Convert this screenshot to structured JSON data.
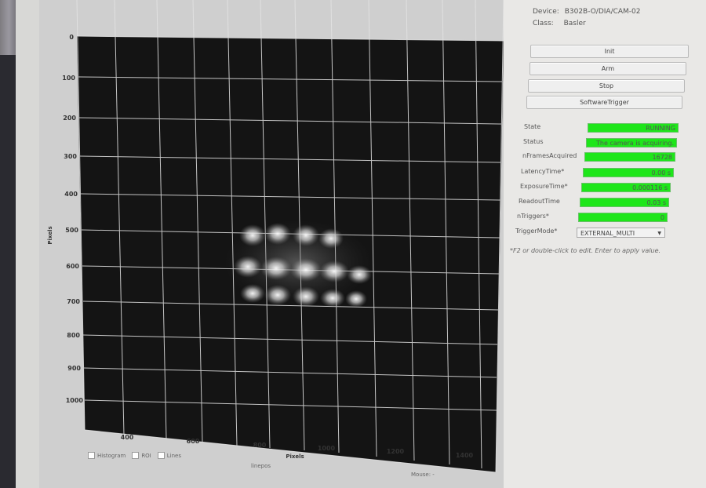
{
  "device": {
    "device_label": "Device:",
    "device_value": "B302B-O/DIA/CAM-02",
    "class_label": "Class:",
    "class_value": "Basler"
  },
  "buttons": {
    "init": "Init",
    "arm": "Arm",
    "stop": "Stop",
    "software_trigger": "SoftwareTrigger"
  },
  "attributes": [
    {
      "label": "State",
      "value": "RUNNING"
    },
    {
      "label": "Status",
      "value": "The camera is acquiring."
    },
    {
      "label": "nFramesAcquired",
      "value": "16728"
    },
    {
      "label": "LatencyTime*",
      "value": "0.00 s"
    },
    {
      "label": "ExposureTime*",
      "value": "0.000116 s"
    },
    {
      "label": "ReadoutTime",
      "value": "0.03 s"
    },
    {
      "label": "nTriggers*",
      "value": "0"
    }
  ],
  "trigger_mode": {
    "label": "TriggerMode*",
    "value": "EXTERNAL_MULTI"
  },
  "hint": "*F2 or double-click to edit. Enter to apply value.",
  "plot": {
    "y_axis_label": "Pixels",
    "x_axis_label": "Pixels",
    "y_ticks": [
      "0",
      "100",
      "200",
      "300",
      "400",
      "500",
      "600",
      "700",
      "800",
      "900",
      "1000"
    ],
    "x_ticks": [
      "400",
      "600",
      "800",
      "1000",
      "1200",
      "1400"
    ]
  },
  "bottom": {
    "histogram": "Histogram",
    "roi": "ROI",
    "lines": "Lines",
    "lineprofile": "linepos",
    "mouse": "Mouse: -"
  },
  "colors": {
    "state_green": "#1ee61a",
    "image_bg": "#141414"
  }
}
